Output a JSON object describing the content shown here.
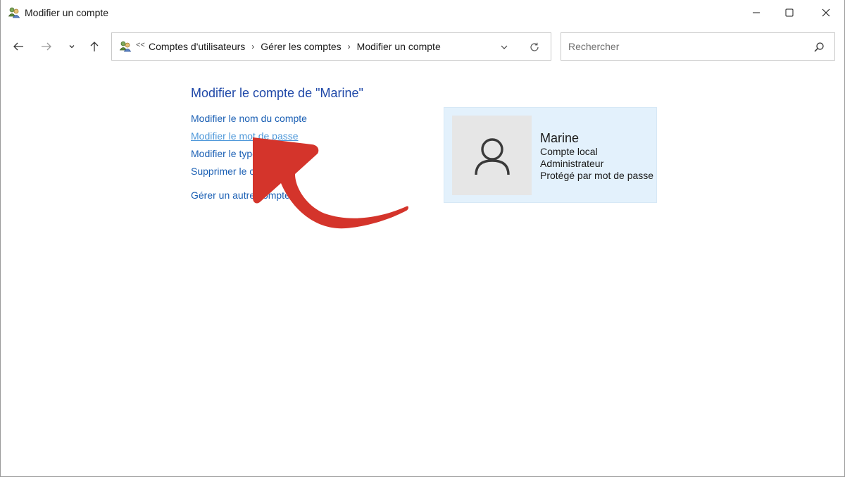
{
  "window": {
    "title": "Modifier un compte"
  },
  "navbar": {
    "breadcrumb_overflow": "<<",
    "crumbs": [
      "Comptes d'utilisateurs",
      "Gérer les comptes",
      "Modifier un compte"
    ],
    "search_placeholder": "Rechercher"
  },
  "main": {
    "heading": "Modifier le compte de \"Marine\"",
    "links": {
      "rename": "Modifier le nom du compte",
      "password": "Modifier le mot de passe",
      "type": "Modifier le type de compte",
      "delete": "Supprimer le compte",
      "manage_other": "Gérer un autre compte"
    }
  },
  "account": {
    "name": "Marine",
    "kind": "Compte local",
    "role": "Administrateur",
    "protection": "Protégé par mot de passe"
  },
  "colors": {
    "link": "#1a5fb4",
    "heading": "#1f48a8",
    "card_bg": "#e3f1fc",
    "annotation_arrow": "#d4342b"
  },
  "icons": [
    "user-accounts-icon",
    "minimize-icon",
    "maximize-icon",
    "close-icon",
    "back-arrow-icon",
    "forward-arrow-icon",
    "recent-locations-chevron-icon",
    "up-arrow-icon",
    "address-dropdown-icon",
    "refresh-icon",
    "search-icon",
    "user-avatar-icon",
    "annotation-arrow"
  ]
}
